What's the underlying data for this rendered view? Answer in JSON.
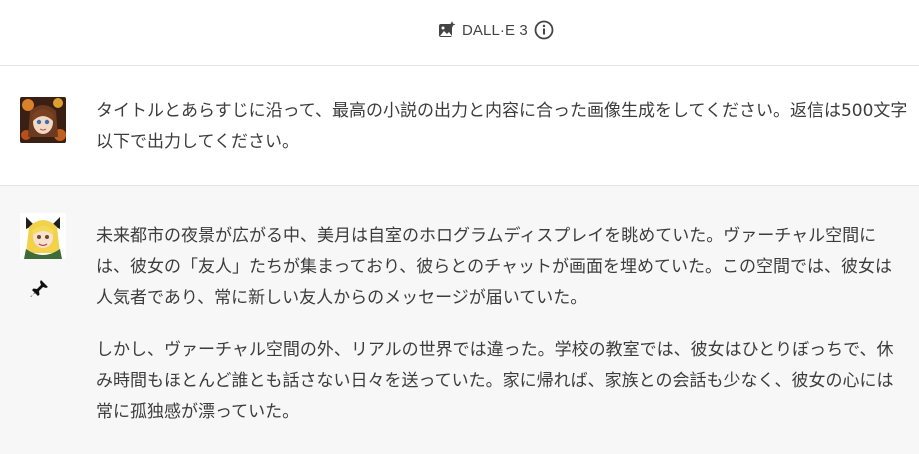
{
  "header": {
    "model_name": "DALL·E 3",
    "model_icon": "image-sparkle-icon",
    "info_icon": "info-icon"
  },
  "messages": [
    {
      "role": "user",
      "avatar": "user-avatar",
      "text": "タイトルとあらすじに沿って、最高の小説の出力と内容に合った画像生成をしてください。返信は500文字以下で出力してください。"
    },
    {
      "role": "assistant",
      "avatar": "assistant-avatar",
      "pin_icon": "pin-icon",
      "paragraphs": [
        "未来都市の夜景が広がる中、美月は自室のホログラムディスプレイを眺めていた。ヴァーチャル空間には、彼女の「友人」たちが集まっており、彼らとのチャットが画面を埋めていた。この空間では、彼女は人気者であり、常に新しい友人からのメッセージが届いていた。",
        "しかし、ヴァーチャル空間の外、リアルの世界では違った。学校の教室では、彼女はひとりぼっちで、休み時間もほとんど誰とも話さない日々を送っていた。家に帰れば、家族との会話も少なく、彼女の心には常に孤独感が漂っていた。"
      ]
    }
  ],
  "colors": {
    "assistant_bg": "#f7f7f8",
    "border": "#e5e5e5",
    "text": "#3c3c3c"
  }
}
